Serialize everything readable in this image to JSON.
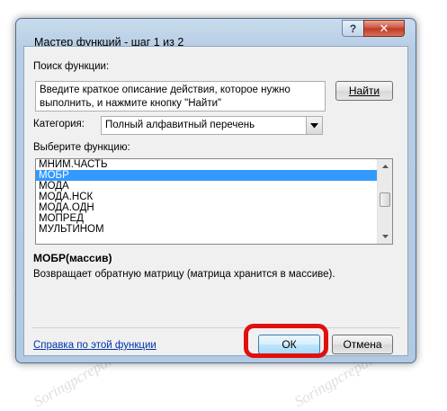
{
  "window": {
    "title": "Мастер функций - шаг 1 из 2",
    "help_glyph": "?",
    "close_glyph": "✕"
  },
  "search": {
    "label": "Поиск функции:",
    "text_line1": "Введите краткое описание действия, которое нужно",
    "text_line2": "выполнить, и нажмите кнопку \"Найти\"",
    "find_button": "Найти"
  },
  "category": {
    "label": "Категория:",
    "selected": "Полный алфавитный перечень"
  },
  "function_list": {
    "label": "Выберите функцию:",
    "items": [
      {
        "text": "МНИМ.ЧАСТЬ",
        "selected": false
      },
      {
        "text": "МОБР",
        "selected": true
      },
      {
        "text": "МОДА",
        "selected": false
      },
      {
        "text": "МОДА.НСК",
        "selected": false
      },
      {
        "text": "МОДА.ОДН",
        "selected": false
      },
      {
        "text": "МОПРЕД",
        "selected": false
      },
      {
        "text": "МУЛЬТИНОМ",
        "selected": false
      }
    ],
    "scroll_position": 0.45
  },
  "details": {
    "signature": "МОБР(массив)",
    "description": "Возвращает обратную матрицу (матрица хранится в массиве)."
  },
  "footer": {
    "help_link": "Справка по этой функции",
    "ok_button": "ОК",
    "cancel_button": "Отмена"
  },
  "watermark_text": "Soringpcrepair.com",
  "colors": {
    "selection": "#3399ff",
    "highlight_ring": "#e01010",
    "link": "#0033aa"
  }
}
